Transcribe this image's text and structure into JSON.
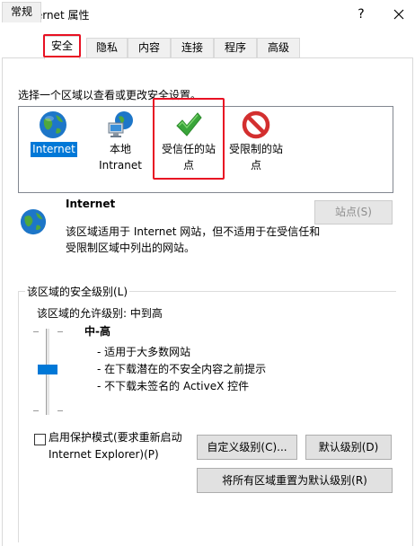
{
  "window": {
    "title": "Internet 属性",
    "help_glyph": "?",
    "close_glyph": "✕"
  },
  "tabs": [
    {
      "label": "常规"
    },
    {
      "label": "安全"
    },
    {
      "label": "隐私"
    },
    {
      "label": "内容"
    },
    {
      "label": "连接"
    },
    {
      "label": "程序"
    },
    {
      "label": "高级"
    }
  ],
  "security": {
    "instruction": "选择一个区域以查看或更改安全设置。",
    "zones": [
      {
        "line1": "Internet",
        "line2": "",
        "icon": "globe-icon"
      },
      {
        "line1": "本地",
        "line2": "Intranet",
        "icon": "intranet-icon"
      },
      {
        "line1": "受信任的站",
        "line2": "点",
        "icon": "checkmark-icon"
      },
      {
        "line1": "受限制的站",
        "line2": "点",
        "icon": "restricted-icon"
      }
    ],
    "selected_zone": "Internet",
    "detail_title": "Internet",
    "detail_desc": "该区域适用于 Internet 网站，但不适用于在受信任和受限制区域中列出的网站。",
    "sites_button": "站点(S)",
    "group_title": "该区域的安全级别(L)",
    "allowed_levels": "该区域的允许级别: 中到高",
    "level_name": "中-高",
    "bullets": [
      "- 适用于大多数网站",
      "- 在下载潜在的不安全内容之前提示",
      "- 不下载未签名的 ActiveX 控件"
    ],
    "protected_mode_line1": "启用保护模式(要求重新启动",
    "protected_mode_line2": "Internet Explorer)(P)",
    "protected_mode_checked": false,
    "custom_level_button": "自定义级别(C)...",
    "default_level_button": "默认级别(D)",
    "reset_all_button": "将所有区域重置为默认级别(R)"
  },
  "colors": {
    "accent": "#0078d7",
    "highlight_red": "#e81123"
  }
}
